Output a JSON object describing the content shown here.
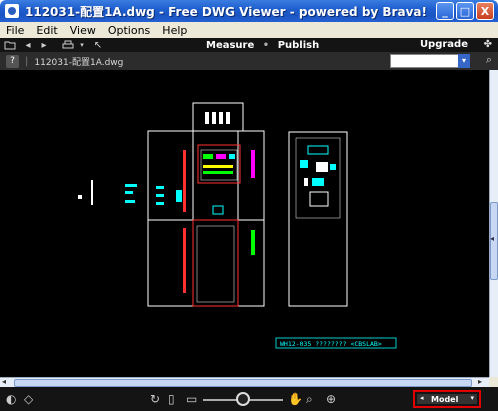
{
  "window": {
    "title": "112031-配置1A.dwg - Free DWG Viewer - powered by Brava!",
    "minimize": "_",
    "maximize": "□",
    "close": "X"
  },
  "menu": {
    "items": [
      "File",
      "Edit",
      "View",
      "Options",
      "Help"
    ]
  },
  "toolbar": {
    "measure_label": "Measure",
    "publish_label": "Publish",
    "separator": "•",
    "upgrade_label": "Upgrade"
  },
  "filebar": {
    "help": "?",
    "filename": "112031-配置1A.dwg"
  },
  "drawing": {
    "title_block_text": "WH12-035  ????????    <CBSLAB>"
  },
  "statusbar": {
    "model_label": "Model"
  },
  "colors": {
    "line": "#ffffff",
    "accent_red": "#e00000",
    "cad_cyan": "#00ffff",
    "cad_green": "#00ff00",
    "cad_magenta": "#ff00ff",
    "cad_red": "#ff3030",
    "cad_yellow": "#ffff00"
  }
}
